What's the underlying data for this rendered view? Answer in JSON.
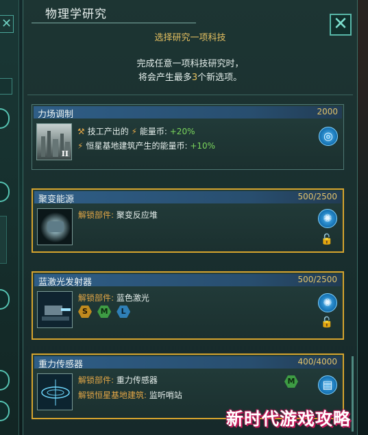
{
  "window": {
    "title": "物理学研究",
    "subtitle": "选择研究一项科技",
    "info_line1": "完成任意一项科技研究时，",
    "info_line2_prefix": "将会产生最多",
    "info_line2_count": "3",
    "info_line2_suffix": "个新选项。",
    "close_symbol": "✕"
  },
  "techs": [
    {
      "name": "力场调制",
      "cost": "2000",
      "tier_badge": "II",
      "lines": [
        {
          "prefix": "技工产出的",
          "resource": "能量币:",
          "value": "+20%"
        },
        {
          "prefix": "恒星基地建筑产生的能量币:",
          "resource": "",
          "value": "+10%"
        }
      ],
      "icon": "shield-research-icon"
    },
    {
      "name": "聚变能源",
      "cost": "500/2500",
      "unlock_label": "解锁部件:",
      "unlock_value": "聚变反应堆",
      "icon": "reactor-research-icon"
    },
    {
      "name": "蓝激光发射器",
      "cost": "500/2500",
      "unlock_label": "解锁部件:",
      "unlock_value": "蓝色激光",
      "slots": [
        "S",
        "M",
        "L"
      ],
      "icon": "weapon-research-icon"
    },
    {
      "name": "重力传感器",
      "cost": "400/4000",
      "unlock_label": "解锁部件:",
      "unlock_value": "重力传感器",
      "unlock2_label": "解锁恒星基地建筑:",
      "unlock2_value": "监听哨站",
      "slot": "M",
      "icon": "building-research-icon"
    }
  ],
  "watermark": "新时代游戏攻略",
  "colors": {
    "accent_gold": "#d7a52e",
    "positive_green": "#7bd65c",
    "unlock_orange": "#e2a646",
    "header_blue": "#2f5e87"
  }
}
